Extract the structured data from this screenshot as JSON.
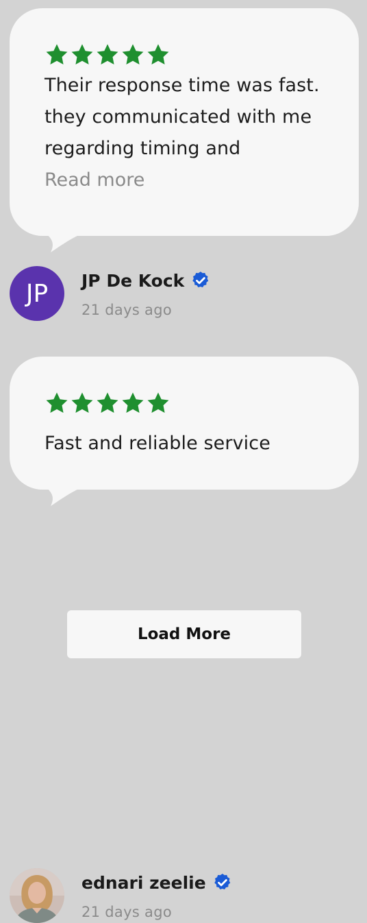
{
  "colors": {
    "background": "#d3d3d3",
    "card": "#f7f7f7",
    "star": "#1f8f2f",
    "verified": "#1a5bd6",
    "muted_text": "#8a8a8a",
    "initials_avatar": "#5a33ad"
  },
  "reviews": [
    {
      "rating": 5,
      "stars_icon": "star-icon",
      "text": "Their response time was fast. they communicated with me regarding timing and",
      "read_more_label": "Read more",
      "author_name": "JP De Kock",
      "author_initials": "JP",
      "verified_icon": "verified-badge-icon",
      "date": "21 days ago"
    },
    {
      "rating": 5,
      "stars_icon": "star-icon",
      "text": "Fast and reliable service",
      "author_name": "ednari zeelie",
      "avatar_icon": "profile-photo",
      "verified_icon": "verified-badge-icon",
      "date": "21 days ago"
    }
  ],
  "load_more_label": "Load More"
}
